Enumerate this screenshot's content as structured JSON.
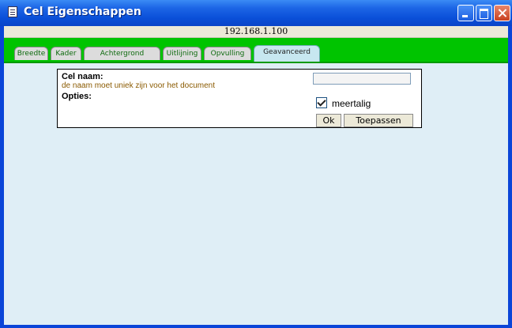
{
  "window": {
    "title": "Cel Eigenschappen",
    "icon": "document-icon",
    "controls": [
      "minimize-icon",
      "maximize-icon",
      "close-icon"
    ]
  },
  "address": "192.168.1.100",
  "tabs": [
    {
      "label": "Breedte",
      "active": false
    },
    {
      "label": "Kader",
      "active": false
    },
    {
      "label": "Achtergrond",
      "active": false
    },
    {
      "label": "Uitlijning",
      "active": false
    },
    {
      "label": "Opvulling",
      "active": false
    },
    {
      "label": "Geavanceerd",
      "active": true
    }
  ],
  "form": {
    "cell_name_label": "Cel naam:",
    "cell_name_hint": "de naam moet uniek zijn voor het document",
    "cell_name_value": "",
    "options_label": "Opties:",
    "multilingual_label": "meertalig",
    "multilingual_checked": true,
    "ok_label": "Ok",
    "apply_label": "Toepassen"
  },
  "colors": {
    "titlebar": "#0a4fd8",
    "tabstrip": "#00c400",
    "content_bg": "#dfeef6",
    "hint_text": "#8a5a00"
  }
}
